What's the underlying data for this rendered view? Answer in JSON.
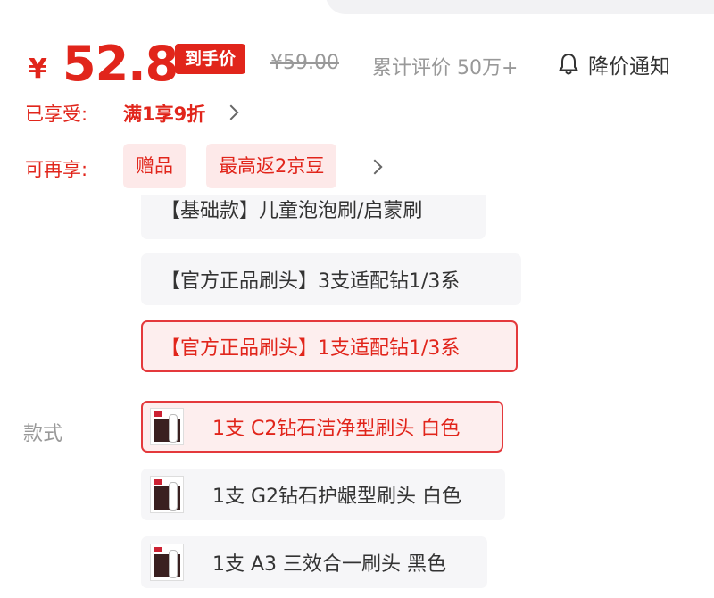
{
  "price": {
    "currency": "¥",
    "value": "52.8",
    "badge": "到手价",
    "original": "¥59.00",
    "reviews": "累计评价 50万+",
    "notify": "降价通知"
  },
  "promos": {
    "enjoyed_label": "已享受:",
    "enjoyed_value": "满1享9折",
    "more_label": "可再享:",
    "tags": [
      "赠品",
      "最高返2京豆"
    ]
  },
  "options": {
    "style_label": "款式",
    "items": [
      {
        "label": "【基础款】儿童泡泡刷/启蒙刷",
        "selected": false
      },
      {
        "label": "【官方正品刷头】3支适配钻1/3系",
        "selected": false
      },
      {
        "label": "【官方正品刷头】1支适配钻1/3系",
        "selected": true
      },
      {
        "label": "1支 C2钻石洁净型刷头 白色",
        "selected": true
      },
      {
        "label": "1支 G2钻石护龈型刷头 白色",
        "selected": false
      },
      {
        "label": "1支 A3 三效合一刷头 黑色",
        "selected": false
      }
    ]
  },
  "colors": {
    "accent": "#e1251b",
    "tag_bg": "#fde9e9",
    "chip_bg": "#f6f6f8"
  },
  "icons": [
    "bell-icon",
    "chevron-right-icon"
  ]
}
